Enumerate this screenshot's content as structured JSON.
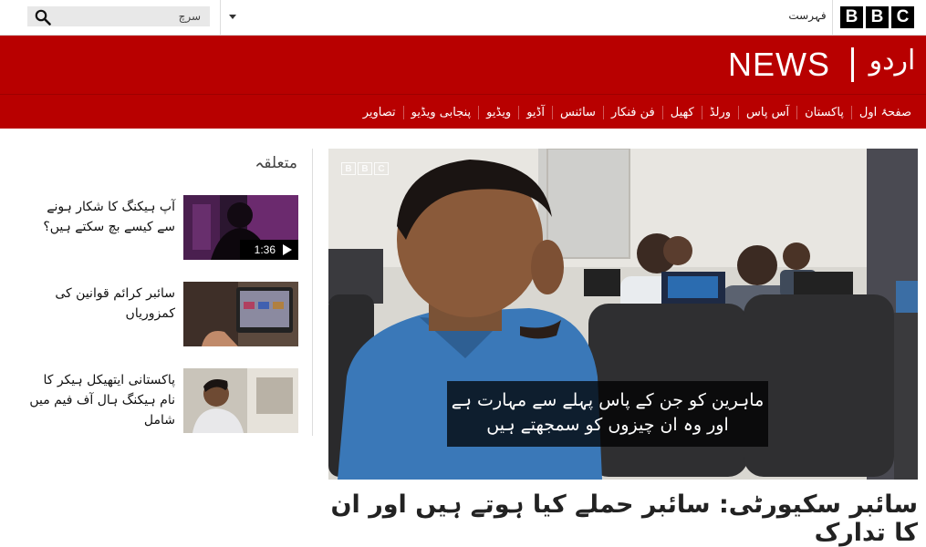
{
  "topbar": {
    "search_placeholder": "سرچ",
    "menu_label": "فہرست",
    "brand_letters": [
      "B",
      "B",
      "C"
    ]
  },
  "masthead": {
    "news_wordmark": "NEWS",
    "site_name": "اردو"
  },
  "nav": {
    "items": [
      "صفحۂ اول",
      "پاکستان",
      "آس پاس",
      "ورلڈ",
      "کھیل",
      "فن فنکار",
      "سائنس",
      "آڈیو",
      "ویڈیو",
      "پنجابی ویڈیو",
      "تصاویر"
    ]
  },
  "hero": {
    "watermark_letters": [
      "B",
      "B",
      "C"
    ],
    "caption_line1": "ماہرین کو جن کے پاس پہلے سے مہارت ہے",
    "caption_line2": "اور وہ ان چیزوں کو سمجھتے ہیں",
    "headline": "سائبر سکیورٹی: سائبر حملے کیا ہوتے ہیں اور ان کا تدارک"
  },
  "related": {
    "title": "متعلقہ",
    "stories": [
      {
        "title": "آپ ہیکنگ کا شکار ہونے سے کیسے بچ سکتے ہیں؟",
        "duration": "1:36"
      },
      {
        "title": "سائبر کرائم قوانین کی کمزوریاں"
      },
      {
        "title": "پاکستانی ایتھیکل ہیکر کا نام ہیکنگ ہال آف فیم میں شامل"
      }
    ]
  },
  "colors": {
    "brand_red": "#b80000",
    "caption_bg": "#000000"
  }
}
